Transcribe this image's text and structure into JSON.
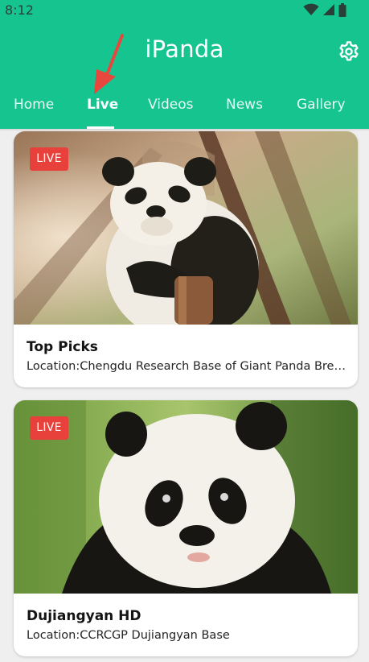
{
  "status_bar": {
    "time": "8:12",
    "icons": [
      "wifi-icon",
      "signal-icon",
      "battery-icon"
    ]
  },
  "header": {
    "title": "iPanda",
    "settings_icon": "gear-icon",
    "tabs": [
      {
        "label": "Home",
        "active": false
      },
      {
        "label": "Live",
        "active": true
      },
      {
        "label": "Videos",
        "active": false
      },
      {
        "label": "News",
        "active": false
      },
      {
        "label": "Gallery",
        "active": false
      }
    ]
  },
  "cards": [
    {
      "badge": "LIVE",
      "title": "Top Picks",
      "location": "Location:Chengdu Research Base of Giant Panda Breeding"
    },
    {
      "badge": "LIVE",
      "title": "Dujiangyan HD",
      "location": "Location:CCRCGP Dujiangyan Base"
    }
  ],
  "colors": {
    "brand": "#16c48f",
    "live_badge": "#e8403a",
    "annotation_arrow": "#e8473e",
    "background": "#efefef"
  }
}
